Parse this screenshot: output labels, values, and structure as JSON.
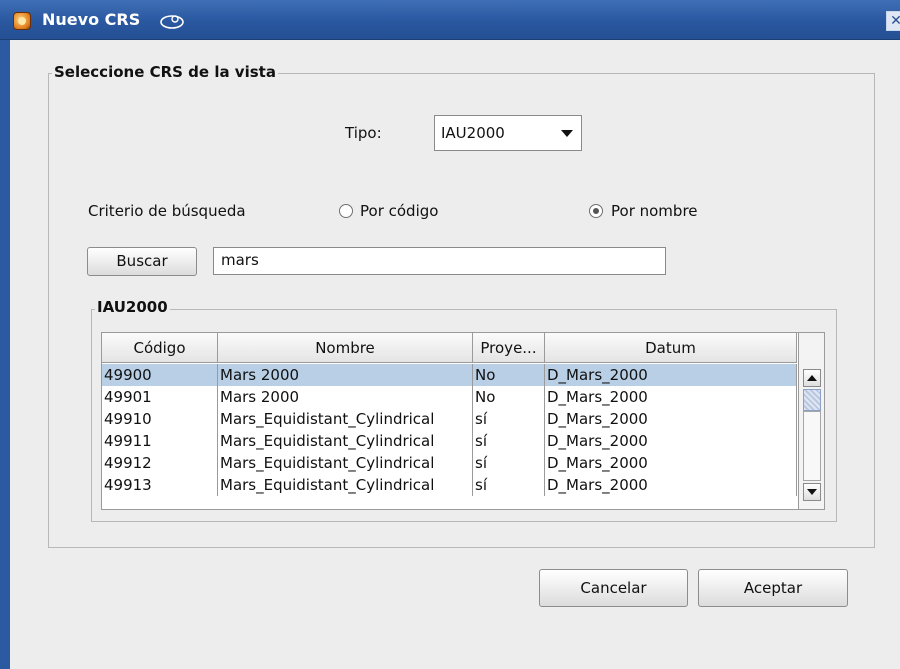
{
  "window": {
    "title": "Nuevo CRS",
    "close_glyph": "✕"
  },
  "view_group": {
    "legend": "Seleccione CRS de la vista"
  },
  "tipo": {
    "label": "Tipo:",
    "selected": "IAU2000"
  },
  "criteria": {
    "label": "Criterio de búsqueda",
    "by_code": "Por código",
    "by_name": "Por nombre",
    "selected": "by_name"
  },
  "search": {
    "button_label": "Buscar",
    "value": "mars"
  },
  "results_group": {
    "legend": "IAU2000"
  },
  "table": {
    "columns": [
      "Código",
      "Nombre",
      "Proye...",
      "Datum"
    ],
    "rows": [
      [
        "49900",
        "Mars 2000",
        "No",
        "D_Mars_2000"
      ],
      [
        "49901",
        "Mars 2000",
        "No",
        "D_Mars_2000"
      ],
      [
        "49910",
        "Mars_Equidistant_Cylindrical",
        "sí",
        "D_Mars_2000"
      ],
      [
        "49911",
        "Mars_Equidistant_Cylindrical",
        "sí",
        "D_Mars_2000"
      ],
      [
        "49912",
        "Mars_Equidistant_Cylindrical",
        "sí",
        "D_Mars_2000"
      ],
      [
        "49913",
        "Mars_Equidistant_Cylindrical",
        "sí",
        "D_Mars_2000"
      ]
    ],
    "selected_row": 0
  },
  "footer": {
    "cancel_label": "Cancelar",
    "accept_label": "Aceptar"
  },
  "icons": {
    "app": "gvsig-app-icon",
    "dropdown": "chevron-down-icon",
    "scroll_up": "arrow-up-icon",
    "scroll_down": "arrow-down-icon"
  },
  "colors": {
    "titlebar": "#2a58a0",
    "selection": "#b8cfe5",
    "background": "#ededed"
  }
}
